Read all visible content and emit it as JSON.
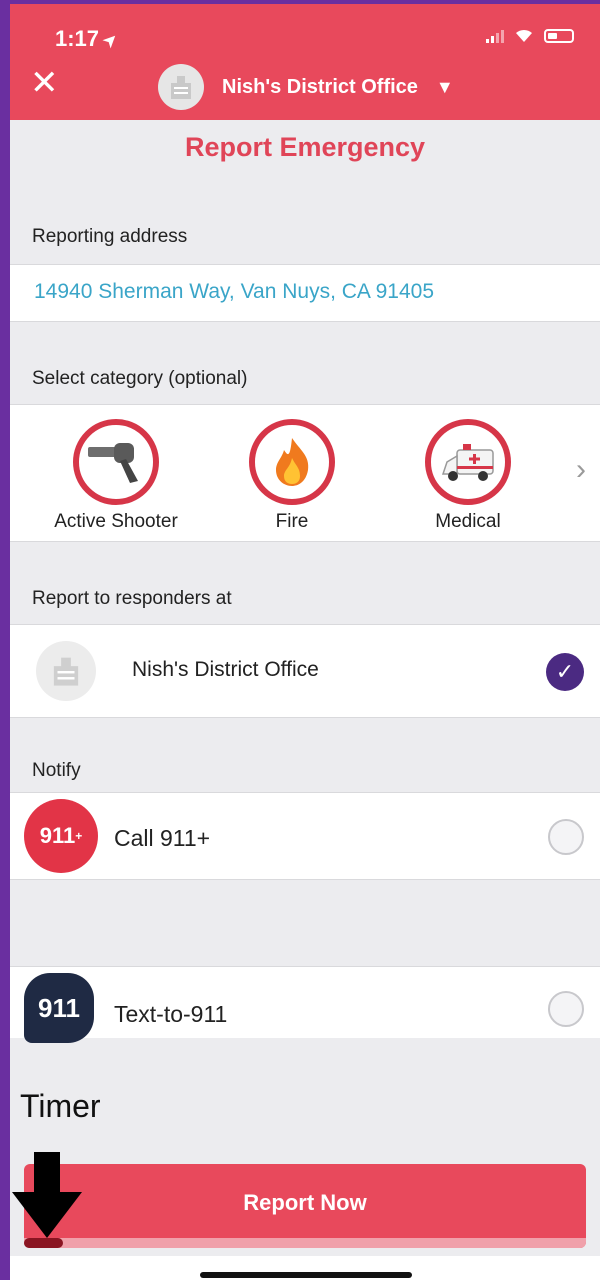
{
  "status_bar": {
    "time": "1:17"
  },
  "header": {
    "office_name": "Nish's District Office",
    "dropdown_glyph": "▼",
    "close_glyph": "✕"
  },
  "page_title": "Report Emergency",
  "address_section": {
    "label": "Reporting address",
    "address": "14940 Sherman Way, Van Nuys, CA  91405"
  },
  "category_section": {
    "label": "Select category (optional)",
    "items": [
      {
        "label": "Active Shooter",
        "icon": "gun-icon"
      },
      {
        "label": "Fire",
        "icon": "fire-icon"
      },
      {
        "label": "Medical",
        "icon": "ambulance-icon"
      }
    ],
    "more_glyph": "›"
  },
  "responders_section": {
    "label": "Report to responders at",
    "name": "Nish's District Office",
    "selected": true
  },
  "notify_section": {
    "label": "Notify",
    "items": [
      {
        "label": "Call 911+",
        "badge": "911",
        "checked": false
      },
      {
        "label": "Text-to-911",
        "badge": "911",
        "checked": false
      }
    ]
  },
  "timer_label": "Timer",
  "report_button": {
    "label": "Report Now",
    "progress": 0.07
  },
  "colors": {
    "primary": "#e8495c",
    "accent_purple": "#4b2a82",
    "link_blue": "#3aa5c8",
    "background": "#ececef"
  }
}
